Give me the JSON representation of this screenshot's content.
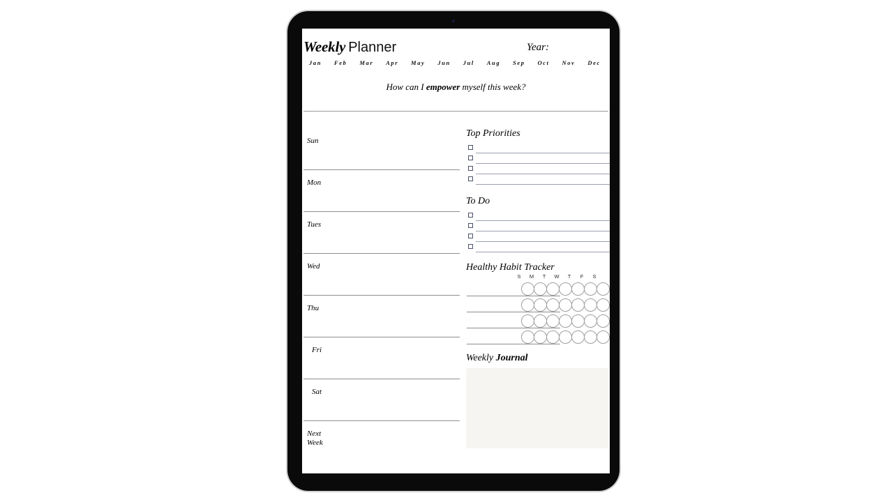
{
  "device": {
    "type": "tablet",
    "camera": "camera-dot"
  },
  "planner": {
    "title_primary": "Weekly",
    "title_secondary": "Planner",
    "year_label": "Year:",
    "months": [
      "Jan",
      "Feb",
      "Mar",
      "Apr",
      "May",
      "Jun",
      "Jul",
      "Aug",
      "Sep",
      "Oct",
      "Nov",
      "Dec"
    ],
    "prompt": {
      "before": "How can I ",
      "emphasis": "empower",
      "after": " myself this week?"
    },
    "days": [
      {
        "label": "Sun",
        "label_line2": "",
        "indent": false
      },
      {
        "label": "Mon",
        "label_line2": "",
        "indent": false
      },
      {
        "label": "Tues",
        "label_line2": "",
        "indent": false
      },
      {
        "label": "Wed",
        "label_line2": "",
        "indent": false
      },
      {
        "label": "Thu",
        "label_line2": "",
        "indent": false
      },
      {
        "label": "Fri",
        "label_line2": "",
        "indent": true
      },
      {
        "label": "Sat",
        "label_line2": "",
        "indent": true
      },
      {
        "label": "Next",
        "label_line2": "Week",
        "indent": false
      }
    ],
    "top_priorities": {
      "title": "Top Priorities",
      "rows": 4,
      "values": [
        "",
        "",
        "",
        ""
      ]
    },
    "to_do": {
      "title": "To Do",
      "rows": 4,
      "values": [
        "",
        "",
        "",
        ""
      ]
    },
    "habit_tracker": {
      "title": "Healthy Habit Tracker",
      "day_initials": [
        "S",
        "M",
        "T",
        "W",
        "T",
        "F",
        "S"
      ],
      "rows": [
        {
          "habit": "",
          "marks": [
            false,
            false,
            false,
            false,
            false,
            false,
            false
          ]
        },
        {
          "habit": "",
          "marks": [
            false,
            false,
            false,
            false,
            false,
            false,
            false
          ]
        },
        {
          "habit": "",
          "marks": [
            false,
            false,
            false,
            false,
            false,
            false,
            false
          ]
        },
        {
          "habit": "",
          "marks": [
            false,
            false,
            false,
            false,
            false,
            false,
            false
          ]
        }
      ]
    },
    "journal": {
      "title_normal": "Weekly ",
      "title_bold": "Journal",
      "content": ""
    }
  },
  "colors": {
    "page_background": "#ffffff",
    "bezel": "#0a0a0a",
    "rule": "#8d8d8d",
    "checkbox_border": "#4a5268",
    "writing_line": "#9aa0ad",
    "journal_fill": "#f7f5f1",
    "camera": "#161a3a"
  }
}
